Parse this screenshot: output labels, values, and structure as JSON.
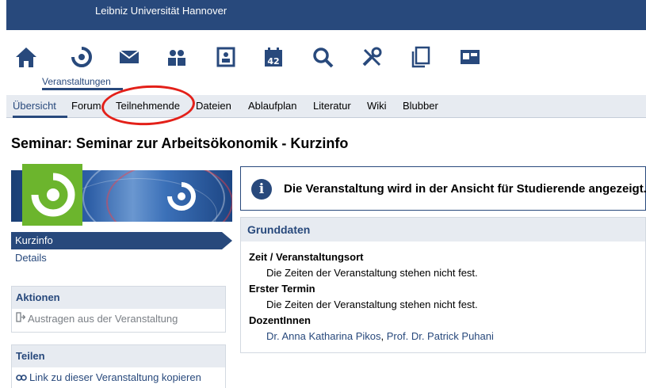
{
  "header": {
    "university": "Leibniz Universität Hannover"
  },
  "main_nav": {
    "icons": [
      "home-icon",
      "courses-icon",
      "mail-icon",
      "community-icon",
      "profile-icon",
      "calendar-icon",
      "search-icon",
      "tools-icon",
      "documents-icon",
      "planner-icon"
    ],
    "calendar_day": "42",
    "active_caption": "Veranstaltungen"
  },
  "sub_nav": {
    "tabs": [
      "Übersicht",
      "Forum",
      "Teilnehmende",
      "Dateien",
      "Ablaufplan",
      "Literatur",
      "Wiki",
      "Blubber"
    ],
    "active": "Übersicht"
  },
  "colors": {
    "brand": "#28497c",
    "highlight": "#e32019",
    "logo_green": "#6cb52d"
  },
  "page": {
    "title": "Seminar: Seminar zur Arbeitsökonomik - Kurzinfo"
  },
  "sidebar": {
    "nav": {
      "active_item": "Kurzinfo",
      "item_2": "Details"
    },
    "actions": {
      "title": "Aktionen",
      "leave": "Austragen aus der Veranstaltung"
    },
    "share": {
      "title": "Teilen",
      "copy_link": "Link zu dieser Veranstaltung kopieren"
    }
  },
  "info": {
    "message": "Die Veranstaltung wird in der Ansicht für Studierende angezeigt."
  },
  "grunddaten": {
    "title": "Grunddaten",
    "time_label": "Zeit / Veranstaltungsort",
    "time_value": "Die Zeiten der Veranstaltung stehen nicht fest.",
    "first_label": "Erster Termin",
    "first_value": "Die Zeiten der Veranstaltung stehen nicht fest.",
    "lecturers_label": "DozentInnen",
    "lecturer_1": "Dr. Anna Katharina Pikos",
    "separator": ", ",
    "lecturer_2": "Prof. Dr. Patrick Puhani"
  }
}
